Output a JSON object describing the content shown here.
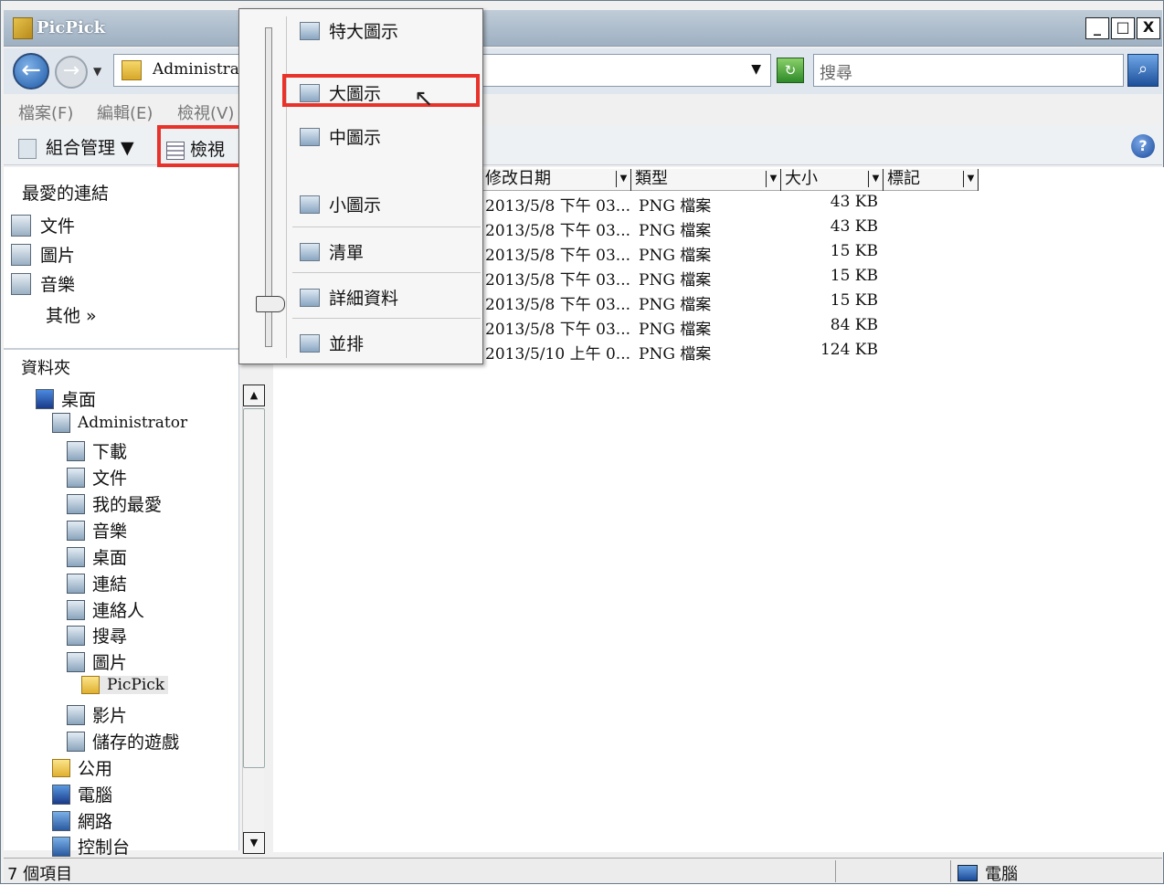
{
  "window": {
    "title": "PicPick",
    "controls": [
      "_",
      "□",
      "X"
    ]
  },
  "address": {
    "path": "Administra",
    "search_placeholder": "搜尋"
  },
  "menubar": [
    "檔案(F)",
    "編輯(E)",
    "檢視(V)"
  ],
  "toolbar": {
    "organize": "組合管理",
    "view": "檢視"
  },
  "favorites": {
    "header": "最愛的連結",
    "items": [
      "文件",
      "圖片",
      "音樂"
    ],
    "more": "其他  »"
  },
  "folders": {
    "header": "資料夾",
    "tree": [
      "桌面",
      "Administrator",
      "下載",
      "文件",
      "我的最愛",
      "音樂",
      "桌面",
      "連結",
      "連絡人",
      "搜尋",
      "圖片",
      "PicPick",
      "影片",
      "儲存的遊戲",
      "公用",
      "電腦",
      "網路",
      "控制台"
    ]
  },
  "view_menu": {
    "items": [
      "特大圖示",
      "大圖示",
      "中圖示",
      "小圖示",
      "清單",
      "詳細資料",
      "並排"
    ],
    "selected": "大圖示"
  },
  "columns": [
    "修改日期",
    "類型",
    "大小",
    "標記"
  ],
  "files": [
    {
      "date": "2013/5/8 下午 03...",
      "type": "PNG 檔案",
      "size": "43 KB"
    },
    {
      "date": "2013/5/8 下午 03...",
      "type": "PNG 檔案",
      "size": "43 KB"
    },
    {
      "date": "2013/5/8 下午 03...",
      "type": "PNG 檔案",
      "size": "15 KB"
    },
    {
      "date": "2013/5/8 下午 03...",
      "type": "PNG 檔案",
      "size": "15 KB"
    },
    {
      "date": "2013/5/8 下午 03...",
      "type": "PNG 檔案",
      "size": "15 KB"
    },
    {
      "date": "2013/5/8 下午 03...",
      "type": "PNG 檔案",
      "size": "84 KB"
    },
    {
      "date": "2013/5/10 上午 0...",
      "type": "PNG 檔案",
      "size": "124 KB"
    }
  ],
  "status": {
    "count": "7 個項目",
    "location": "電腦"
  }
}
